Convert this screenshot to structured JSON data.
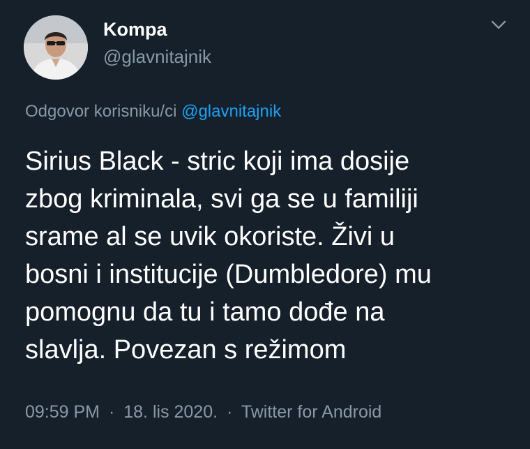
{
  "user": {
    "display_name": "Kompa",
    "handle": "@glavnitajnik",
    "avatar_icon": "profile-photo"
  },
  "reply": {
    "prefix": "Odgovor korisniku/ci",
    "mention": "@glavnitajnik"
  },
  "tweet": {
    "lines": [
      "Sirius Black - stric koji ima dosije",
      "zbog kriminala, svi ga se u familiji",
      "srame al se uvik okoriste. Živi u",
      "bosni i institucije (Dumbledore) mu",
      "pomognu da tu i tamo dođe na",
      "slavlja. Povezan s režimom"
    ]
  },
  "meta": {
    "time": "09:59 PM",
    "separator": "·",
    "date": "18. lis 2020.",
    "source": "Twitter for Android"
  },
  "menu": {
    "icon": "chevron-down-icon"
  },
  "colors": {
    "background": "#15202b",
    "text": "#ffffff",
    "secondary": "#8899a6",
    "link": "#1da1f2"
  }
}
